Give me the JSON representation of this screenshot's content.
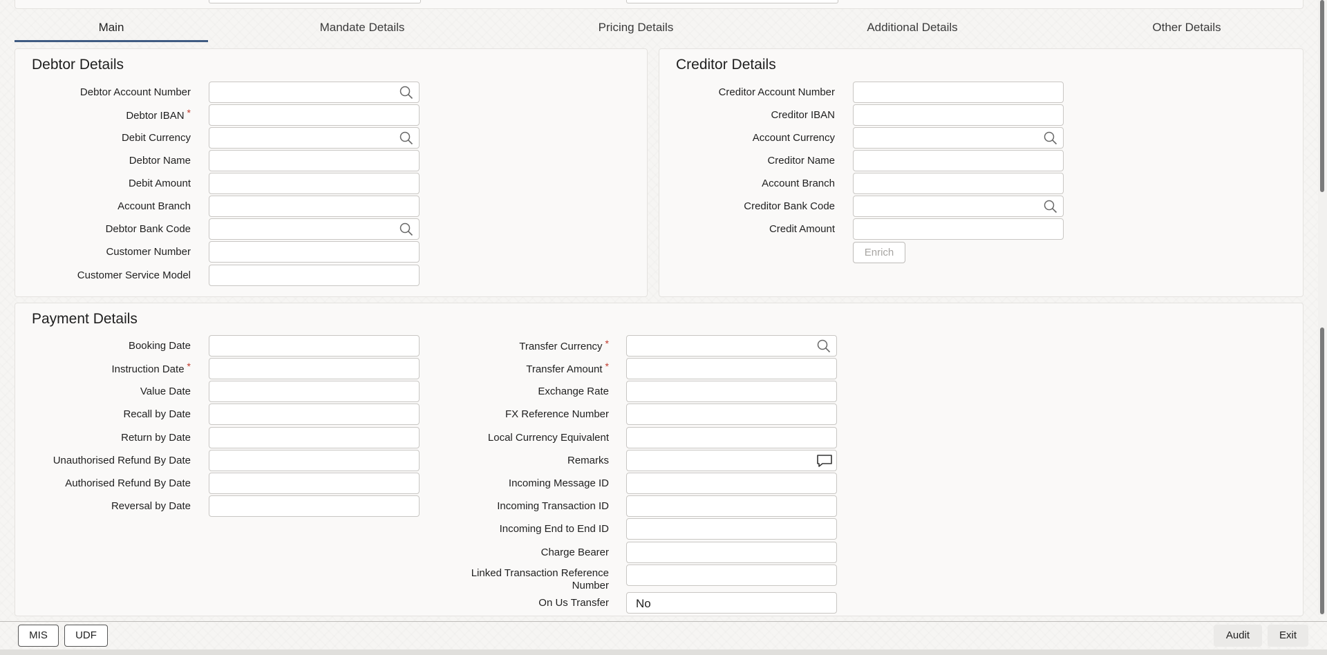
{
  "tabs": [
    {
      "label": "Main"
    },
    {
      "label": "Mandate Details"
    },
    {
      "label": "Pricing Details"
    },
    {
      "label": "Additional Details"
    },
    {
      "label": "Other Details"
    }
  ],
  "debtor": {
    "title": "Debtor Details",
    "fields": {
      "account_number": {
        "label": "Debtor Account Number",
        "value": ""
      },
      "iban": {
        "label": "Debtor IBAN",
        "value": ""
      },
      "debit_currency": {
        "label": "Debit Currency",
        "value": ""
      },
      "name": {
        "label": "Debtor Name",
        "value": ""
      },
      "debit_amount": {
        "label": "Debit Amount",
        "value": ""
      },
      "account_branch": {
        "label": "Account Branch",
        "value": ""
      },
      "bank_code": {
        "label": "Debtor Bank Code",
        "value": ""
      },
      "customer_number": {
        "label": "Customer Number",
        "value": ""
      },
      "service_model": {
        "label": "Customer Service Model",
        "value": ""
      }
    }
  },
  "creditor": {
    "title": "Creditor Details",
    "fields": {
      "account_number": {
        "label": "Creditor Account Number",
        "value": ""
      },
      "iban": {
        "label": "Creditor IBAN",
        "value": ""
      },
      "account_currency": {
        "label": "Account Currency",
        "value": ""
      },
      "name": {
        "label": "Creditor Name",
        "value": ""
      },
      "account_branch": {
        "label": "Account Branch",
        "value": ""
      },
      "bank_code": {
        "label": "Creditor Bank Code",
        "value": ""
      },
      "credit_amount": {
        "label": "Credit Amount",
        "value": ""
      }
    },
    "enrich_label": "Enrich"
  },
  "payment": {
    "title": "Payment Details",
    "left": {
      "booking_date": {
        "label": "Booking Date",
        "value": ""
      },
      "instruction_date": {
        "label": "Instruction Date",
        "value": ""
      },
      "value_date": {
        "label": "Value Date",
        "value": ""
      },
      "recall_by_date": {
        "label": "Recall by Date",
        "value": ""
      },
      "return_by_date": {
        "label": "Return by Date",
        "value": ""
      },
      "unauth_refund": {
        "label": "Unauthorised Refund By Date",
        "value": ""
      },
      "auth_refund": {
        "label": "Authorised Refund By Date",
        "value": ""
      },
      "reversal_by_date": {
        "label": "Reversal by Date",
        "value": ""
      }
    },
    "right": {
      "transfer_currency": {
        "label": "Transfer Currency",
        "value": ""
      },
      "transfer_amount": {
        "label": "Transfer Amount",
        "value": ""
      },
      "exchange_rate": {
        "label": "Exchange Rate",
        "value": ""
      },
      "fx_reference": {
        "label": "FX Reference Number",
        "value": ""
      },
      "local_currency_equiv": {
        "label": "Local Currency Equivalent",
        "value": ""
      },
      "remarks": {
        "label": "Remarks",
        "value": ""
      },
      "incoming_message_id": {
        "label": "Incoming Message ID",
        "value": ""
      },
      "incoming_transaction_id": {
        "label": "Incoming Transaction ID",
        "value": ""
      },
      "incoming_e2e_id": {
        "label": "Incoming End to End ID",
        "value": ""
      },
      "charge_bearer": {
        "label": "Charge Bearer",
        "value": ""
      },
      "linked_txn_ref_line1": "Linked Transaction Reference",
      "linked_txn_ref_line2": "Number",
      "linked_txn_ref_value": "",
      "on_us_transfer": {
        "label": "On Us Transfer",
        "value": "No"
      }
    }
  },
  "footer": {
    "mis": "MIS",
    "udf": "UDF",
    "audit": "Audit",
    "exit": "Exit"
  },
  "colors": {
    "accent": "#3f5b82",
    "required": "#c0392b"
  }
}
